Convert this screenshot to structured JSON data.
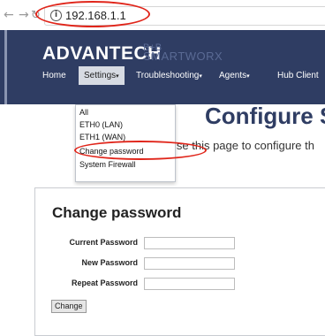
{
  "browser": {
    "url": "192.168.1.1",
    "info_icon": "i"
  },
  "header": {
    "brand": "ADVANTECH",
    "sub_brand_line1": "B+B",
    "sub_brand_line2": "SMARTWORX"
  },
  "nav": {
    "items": [
      {
        "label": "Home"
      },
      {
        "label": "Settings",
        "caret": "▾"
      },
      {
        "label": "Troubleshooting",
        "caret": "▾"
      },
      {
        "label": "Agents",
        "caret": "▾"
      },
      {
        "label": "Hub Client"
      }
    ]
  },
  "dropdown": {
    "items": [
      "All",
      "ETH0 (LAN)",
      "ETH1 (WAN)",
      "Change password",
      "System Firewall"
    ]
  },
  "page": {
    "title": "Configure S",
    "intro": "lse this page to configure th"
  },
  "panel": {
    "title": "Change password",
    "fields": [
      {
        "label": "Current Password",
        "value": ""
      },
      {
        "label": "New Password",
        "value": ""
      },
      {
        "label": "Repeat Password",
        "value": ""
      }
    ],
    "button": "Change"
  },
  "colors": {
    "header_bg": "#2f3d63",
    "annotation": "#e0251a"
  }
}
